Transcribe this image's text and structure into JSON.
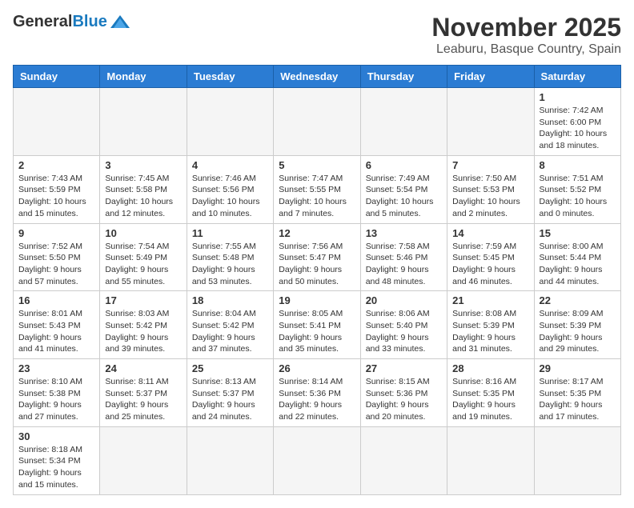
{
  "header": {
    "logo_general": "General",
    "logo_blue": "Blue",
    "month_title": "November 2025",
    "location": "Leaburu, Basque Country, Spain"
  },
  "days_of_week": [
    "Sunday",
    "Monday",
    "Tuesday",
    "Wednesday",
    "Thursday",
    "Friday",
    "Saturday"
  ],
  "weeks": [
    [
      {
        "day": "",
        "empty": true
      },
      {
        "day": "",
        "empty": true
      },
      {
        "day": "",
        "empty": true
      },
      {
        "day": "",
        "empty": true
      },
      {
        "day": "",
        "empty": true
      },
      {
        "day": "",
        "empty": true
      },
      {
        "day": "1",
        "info": "Sunrise: 7:42 AM\nSunset: 6:00 PM\nDaylight: 10 hours\nand 18 minutes."
      }
    ],
    [
      {
        "day": "2",
        "info": "Sunrise: 7:43 AM\nSunset: 5:59 PM\nDaylight: 10 hours\nand 15 minutes."
      },
      {
        "day": "3",
        "info": "Sunrise: 7:45 AM\nSunset: 5:58 PM\nDaylight: 10 hours\nand 12 minutes."
      },
      {
        "day": "4",
        "info": "Sunrise: 7:46 AM\nSunset: 5:56 PM\nDaylight: 10 hours\nand 10 minutes."
      },
      {
        "day": "5",
        "info": "Sunrise: 7:47 AM\nSunset: 5:55 PM\nDaylight: 10 hours\nand 7 minutes."
      },
      {
        "day": "6",
        "info": "Sunrise: 7:49 AM\nSunset: 5:54 PM\nDaylight: 10 hours\nand 5 minutes."
      },
      {
        "day": "7",
        "info": "Sunrise: 7:50 AM\nSunset: 5:53 PM\nDaylight: 10 hours\nand 2 minutes."
      },
      {
        "day": "8",
        "info": "Sunrise: 7:51 AM\nSunset: 5:52 PM\nDaylight: 10 hours\nand 0 minutes."
      }
    ],
    [
      {
        "day": "9",
        "info": "Sunrise: 7:52 AM\nSunset: 5:50 PM\nDaylight: 9 hours\nand 57 minutes."
      },
      {
        "day": "10",
        "info": "Sunrise: 7:54 AM\nSunset: 5:49 PM\nDaylight: 9 hours\nand 55 minutes."
      },
      {
        "day": "11",
        "info": "Sunrise: 7:55 AM\nSunset: 5:48 PM\nDaylight: 9 hours\nand 53 minutes."
      },
      {
        "day": "12",
        "info": "Sunrise: 7:56 AM\nSunset: 5:47 PM\nDaylight: 9 hours\nand 50 minutes."
      },
      {
        "day": "13",
        "info": "Sunrise: 7:58 AM\nSunset: 5:46 PM\nDaylight: 9 hours\nand 48 minutes."
      },
      {
        "day": "14",
        "info": "Sunrise: 7:59 AM\nSunset: 5:45 PM\nDaylight: 9 hours\nand 46 minutes."
      },
      {
        "day": "15",
        "info": "Sunrise: 8:00 AM\nSunset: 5:44 PM\nDaylight: 9 hours\nand 44 minutes."
      }
    ],
    [
      {
        "day": "16",
        "info": "Sunrise: 8:01 AM\nSunset: 5:43 PM\nDaylight: 9 hours\nand 41 minutes."
      },
      {
        "day": "17",
        "info": "Sunrise: 8:03 AM\nSunset: 5:42 PM\nDaylight: 9 hours\nand 39 minutes."
      },
      {
        "day": "18",
        "info": "Sunrise: 8:04 AM\nSunset: 5:42 PM\nDaylight: 9 hours\nand 37 minutes."
      },
      {
        "day": "19",
        "info": "Sunrise: 8:05 AM\nSunset: 5:41 PM\nDaylight: 9 hours\nand 35 minutes."
      },
      {
        "day": "20",
        "info": "Sunrise: 8:06 AM\nSunset: 5:40 PM\nDaylight: 9 hours\nand 33 minutes."
      },
      {
        "day": "21",
        "info": "Sunrise: 8:08 AM\nSunset: 5:39 PM\nDaylight: 9 hours\nand 31 minutes."
      },
      {
        "day": "22",
        "info": "Sunrise: 8:09 AM\nSunset: 5:39 PM\nDaylight: 9 hours\nand 29 minutes."
      }
    ],
    [
      {
        "day": "23",
        "info": "Sunrise: 8:10 AM\nSunset: 5:38 PM\nDaylight: 9 hours\nand 27 minutes."
      },
      {
        "day": "24",
        "info": "Sunrise: 8:11 AM\nSunset: 5:37 PM\nDaylight: 9 hours\nand 25 minutes."
      },
      {
        "day": "25",
        "info": "Sunrise: 8:13 AM\nSunset: 5:37 PM\nDaylight: 9 hours\nand 24 minutes."
      },
      {
        "day": "26",
        "info": "Sunrise: 8:14 AM\nSunset: 5:36 PM\nDaylight: 9 hours\nand 22 minutes."
      },
      {
        "day": "27",
        "info": "Sunrise: 8:15 AM\nSunset: 5:36 PM\nDaylight: 9 hours\nand 20 minutes."
      },
      {
        "day": "28",
        "info": "Sunrise: 8:16 AM\nSunset: 5:35 PM\nDaylight: 9 hours\nand 19 minutes."
      },
      {
        "day": "29",
        "info": "Sunrise: 8:17 AM\nSunset: 5:35 PM\nDaylight: 9 hours\nand 17 minutes."
      }
    ],
    [
      {
        "day": "30",
        "info": "Sunrise: 8:18 AM\nSunset: 5:34 PM\nDaylight: 9 hours\nand 15 minutes."
      },
      {
        "day": "",
        "empty": true
      },
      {
        "day": "",
        "empty": true
      },
      {
        "day": "",
        "empty": true
      },
      {
        "day": "",
        "empty": true
      },
      {
        "day": "",
        "empty": true
      },
      {
        "day": "",
        "empty": true
      }
    ]
  ]
}
